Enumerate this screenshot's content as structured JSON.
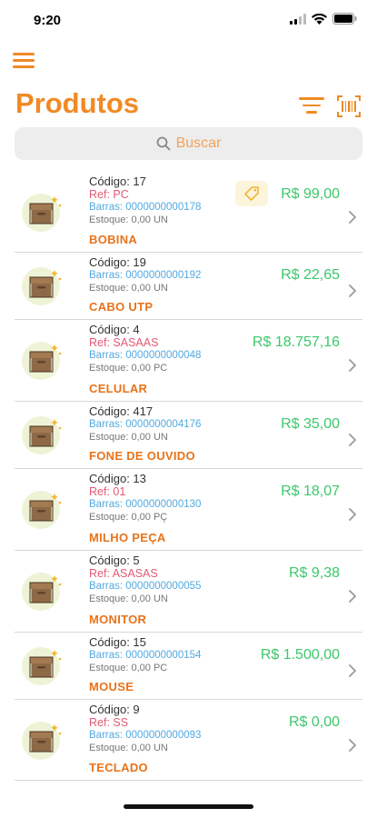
{
  "status": {
    "time": "9:20"
  },
  "header": {
    "title": "Produtos"
  },
  "search": {
    "placeholder": "Buscar"
  },
  "products": [
    {
      "codigo": "Código: 17",
      "ref": "Ref: PC",
      "barras": "Barras: 0000000000178",
      "estoque": "Estoque: 0,00 UN",
      "name": "BOBINA",
      "price": "R$ 99,00",
      "has_tag": true
    },
    {
      "codigo": "Código: 19",
      "ref": "",
      "barras": "Barras: 0000000000192",
      "estoque": "Estoque: 0,00 UN",
      "name": "CABO UTP",
      "price": "R$ 22,65",
      "has_tag": false
    },
    {
      "codigo": "Código: 4",
      "ref": "Ref: SASAAS",
      "barras": "Barras: 0000000000048",
      "estoque": "Estoque: 0,00 PC",
      "name": "CELULAR",
      "price": "R$ 18.757,16",
      "has_tag": false
    },
    {
      "codigo": "Código: 417",
      "ref": "",
      "barras": "Barras: 0000000004176",
      "estoque": "Estoque: 0,00 UN",
      "name": "FONE DE OUVIDO",
      "price": "R$ 35,00",
      "has_tag": false
    },
    {
      "codigo": "Código: 13",
      "ref": "Ref: 01",
      "barras": "Barras: 0000000000130",
      "estoque": "Estoque: 0,00 PÇ",
      "name": "MILHO PEÇA",
      "price": "R$ 18,07",
      "has_tag": false
    },
    {
      "codigo": "Código: 5",
      "ref": "Ref: ASASAS",
      "barras": "Barras: 0000000000055",
      "estoque": "Estoque: 0,00 UN",
      "name": "MONITOR",
      "price": "R$ 9,38",
      "has_tag": false
    },
    {
      "codigo": "Código: 15",
      "ref": "",
      "barras": "Barras: 0000000000154",
      "estoque": "Estoque: 0,00 PC",
      "name": "MOUSE",
      "price": "R$ 1.500,00",
      "has_tag": false
    },
    {
      "codigo": "Código: 9",
      "ref": "Ref: SS",
      "barras": "Barras: 0000000000093",
      "estoque": "Estoque: 0,00 UN",
      "name": "TECLADO",
      "price": "R$ 0,00",
      "has_tag": false
    }
  ],
  "colors": {
    "accent": "#f08a24",
    "price": "#3cc86b",
    "ref": "#e35a74",
    "barras": "#53a9df"
  }
}
